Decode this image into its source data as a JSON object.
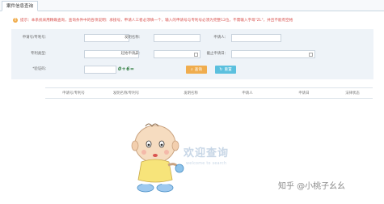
{
  "tab": {
    "label": "案件信息查询"
  },
  "notice": {
    "text": "提示：本系统采用精确查询，查询条件中的各项说明：承接号，申请人三者必须填一个，输入的申请号与专利号必须为完整12位，不需输入字母\"ZL\"，并且不能有空格"
  },
  "form": {
    "application_no_label": "申请号/专利号：",
    "application_no_value": "",
    "patent_name_label": "发明名称：",
    "patent_name_value": "",
    "applicant_label": "申请人：",
    "applicant_value": "",
    "patent_type_label": "专利类型：",
    "patent_type_value": "",
    "start_date_label": "起始申请日：",
    "start_date_value": "",
    "end_date_label": "截止申请日：",
    "end_date_value": "",
    "captcha_label": "*验证码：",
    "captcha_value": "",
    "captcha_text": "0+6=",
    "query_button": "查询",
    "reset_button": "重置"
  },
  "table": {
    "columns": [
      "申请号/专利号",
      "发明名称/专利号",
      "发明名称",
      "申请人",
      "申请日",
      "法律状态"
    ]
  },
  "welcome": {
    "title": "欢迎查询",
    "subtitle": "welcome to search"
  },
  "watermark": {
    "text": "知乎 @小桃子幺幺"
  },
  "colors": {
    "query_button": "#f0ad4e",
    "reset_button": "#5bc0de",
    "notice": "#d9534f",
    "form_bg": "#eef3f8"
  }
}
